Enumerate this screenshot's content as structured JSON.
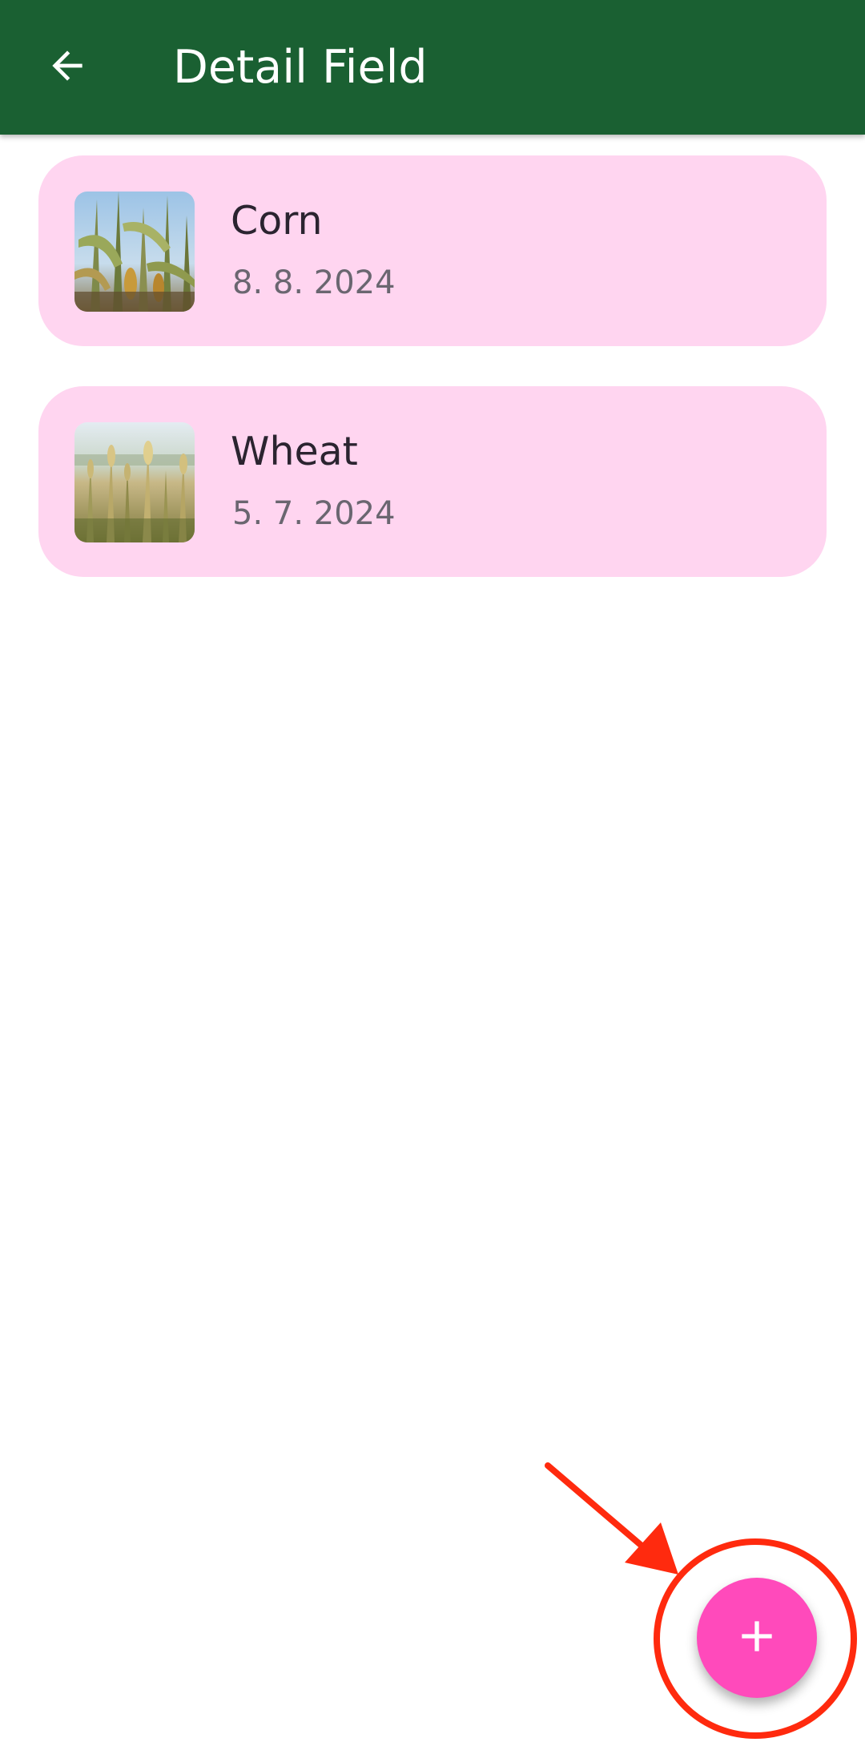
{
  "app_bar": {
    "title": "Detail Field",
    "back_icon": "arrow-back-icon",
    "background": "#1a6032"
  },
  "fields": [
    {
      "name": "Corn",
      "date": "8. 8. 2024",
      "image": "corn-photo"
    },
    {
      "name": "Wheat",
      "date": "5. 7. 2024",
      "image": "wheat-photo"
    }
  ],
  "fab": {
    "icon": "plus-icon",
    "color": "#ff4abb"
  },
  "colors": {
    "card_background": "#ffd5f0",
    "annotation": "#ff2a0e"
  }
}
